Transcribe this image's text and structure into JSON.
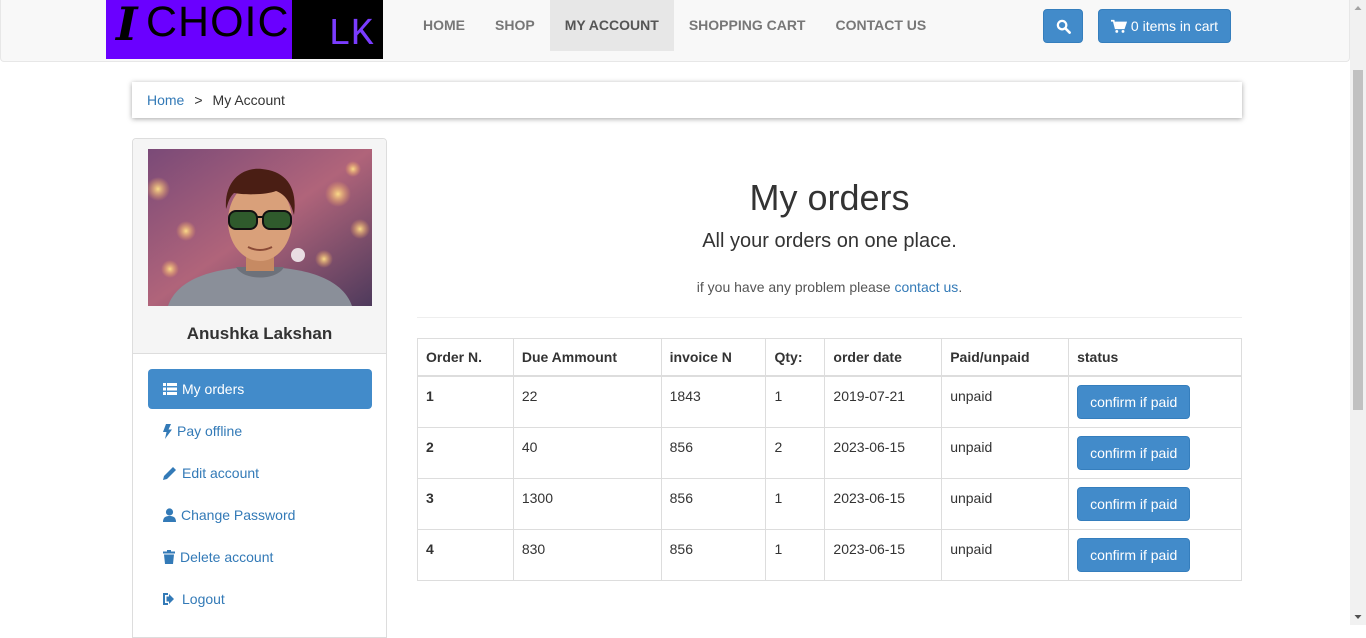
{
  "logo": {
    "i": "I",
    "choice": "CHOICE",
    "lk": "LK"
  },
  "nav": {
    "items": [
      "HOME",
      "SHOP",
      "MY ACCOUNT",
      "SHOPPING CART",
      "CONTACT US"
    ],
    "active": "MY ACCOUNT",
    "cart_label": "0 items in cart"
  },
  "breadcrumb": {
    "home": "Home",
    "separator": ">",
    "current": "My Account"
  },
  "sidebar": {
    "user_name": "Anushka Lakshan",
    "items": [
      {
        "label": "My orders",
        "icon": "list-icon"
      },
      {
        "label": "Pay offline",
        "icon": "bolt-icon"
      },
      {
        "label": "Edit account",
        "icon": "pencil-icon"
      },
      {
        "label": "Change Password",
        "icon": "user-icon"
      },
      {
        "label": "Delete account",
        "icon": "trash-icon"
      },
      {
        "label": "Logout",
        "icon": "logout-icon"
      }
    ]
  },
  "main": {
    "title": "My orders",
    "subtitle": "All your orders on one place.",
    "help_prefix": "if you have any problem please ",
    "help_link": "contact us",
    "help_suffix": "."
  },
  "orders": {
    "headers": [
      "Order N.",
      "Due Ammount",
      "invoice N",
      "Qty:",
      "order date",
      "Paid/unpaid",
      "status"
    ],
    "rows": [
      {
        "order": "1",
        "amount": "22",
        "invoice": "1843",
        "qty": "1",
        "date": "2019-07-21",
        "paid": "unpaid",
        "action": "confirm if paid"
      },
      {
        "order": "2",
        "amount": "40",
        "invoice": "856",
        "qty": "2",
        "date": "2023-06-15",
        "paid": "unpaid",
        "action": "confirm if paid"
      },
      {
        "order": "3",
        "amount": "1300",
        "invoice": "856",
        "qty": "1",
        "date": "2023-06-15",
        "paid": "unpaid",
        "action": "confirm if paid"
      },
      {
        "order": "4",
        "amount": "830",
        "invoice": "856",
        "qty": "1",
        "date": "2023-06-15",
        "paid": "unpaid",
        "action": "confirm if paid"
      }
    ]
  },
  "colors": {
    "primary": "#428bca",
    "logo_purple": "#6a00ff",
    "link": "#337ab7"
  }
}
